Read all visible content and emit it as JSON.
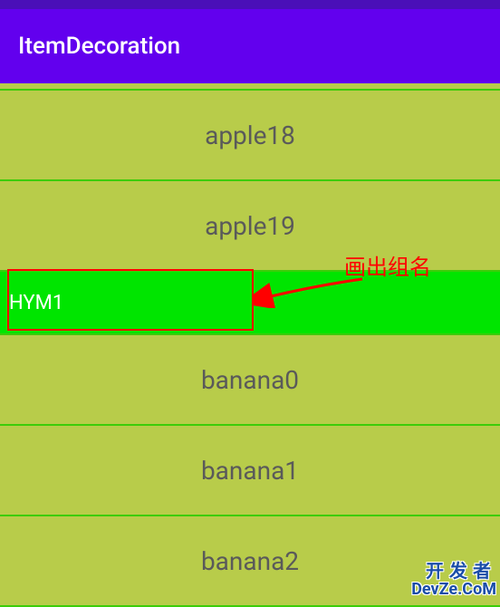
{
  "appBar": {
    "title": "ItemDecoration"
  },
  "list": {
    "items": [
      {
        "label": "apple18"
      },
      {
        "label": "apple19"
      },
      {
        "label": "banana0"
      },
      {
        "label": "banana1"
      },
      {
        "label": "banana2"
      }
    ]
  },
  "groupHeader": {
    "label": "HYM1"
  },
  "annotation": {
    "text": "画出组名"
  },
  "watermark": {
    "line1": "开发者",
    "line2": "DevZe.CoM"
  },
  "colors": {
    "primary": "#6200ee",
    "primaryDark": "#4a0fb8",
    "listBg": "#b8cc4a",
    "divider": "#3ccc0a",
    "groupBg": "#00e500",
    "annotation": "#ff0000"
  }
}
